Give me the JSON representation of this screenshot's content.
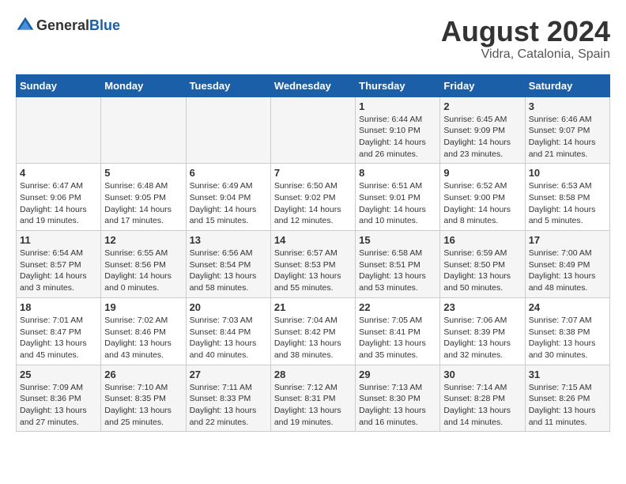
{
  "header": {
    "logo_general": "General",
    "logo_blue": "Blue",
    "month_year": "August 2024",
    "location": "Vidra, Catalonia, Spain"
  },
  "days_of_week": [
    "Sunday",
    "Monday",
    "Tuesday",
    "Wednesday",
    "Thursday",
    "Friday",
    "Saturday"
  ],
  "weeks": [
    [
      {
        "day": "",
        "info": ""
      },
      {
        "day": "",
        "info": ""
      },
      {
        "day": "",
        "info": ""
      },
      {
        "day": "",
        "info": ""
      },
      {
        "day": "1",
        "info": "Sunrise: 6:44 AM\nSunset: 9:10 PM\nDaylight: 14 hours\nand 26 minutes."
      },
      {
        "day": "2",
        "info": "Sunrise: 6:45 AM\nSunset: 9:09 PM\nDaylight: 14 hours\nand 23 minutes."
      },
      {
        "day": "3",
        "info": "Sunrise: 6:46 AM\nSunset: 9:07 PM\nDaylight: 14 hours\nand 21 minutes."
      }
    ],
    [
      {
        "day": "4",
        "info": "Sunrise: 6:47 AM\nSunset: 9:06 PM\nDaylight: 14 hours\nand 19 minutes."
      },
      {
        "day": "5",
        "info": "Sunrise: 6:48 AM\nSunset: 9:05 PM\nDaylight: 14 hours\nand 17 minutes."
      },
      {
        "day": "6",
        "info": "Sunrise: 6:49 AM\nSunset: 9:04 PM\nDaylight: 14 hours\nand 15 minutes."
      },
      {
        "day": "7",
        "info": "Sunrise: 6:50 AM\nSunset: 9:02 PM\nDaylight: 14 hours\nand 12 minutes."
      },
      {
        "day": "8",
        "info": "Sunrise: 6:51 AM\nSunset: 9:01 PM\nDaylight: 14 hours\nand 10 minutes."
      },
      {
        "day": "9",
        "info": "Sunrise: 6:52 AM\nSunset: 9:00 PM\nDaylight: 14 hours\nand 8 minutes."
      },
      {
        "day": "10",
        "info": "Sunrise: 6:53 AM\nSunset: 8:58 PM\nDaylight: 14 hours\nand 5 minutes."
      }
    ],
    [
      {
        "day": "11",
        "info": "Sunrise: 6:54 AM\nSunset: 8:57 PM\nDaylight: 14 hours\nand 3 minutes."
      },
      {
        "day": "12",
        "info": "Sunrise: 6:55 AM\nSunset: 8:56 PM\nDaylight: 14 hours\nand 0 minutes."
      },
      {
        "day": "13",
        "info": "Sunrise: 6:56 AM\nSunset: 8:54 PM\nDaylight: 13 hours\nand 58 minutes."
      },
      {
        "day": "14",
        "info": "Sunrise: 6:57 AM\nSunset: 8:53 PM\nDaylight: 13 hours\nand 55 minutes."
      },
      {
        "day": "15",
        "info": "Sunrise: 6:58 AM\nSunset: 8:51 PM\nDaylight: 13 hours\nand 53 minutes."
      },
      {
        "day": "16",
        "info": "Sunrise: 6:59 AM\nSunset: 8:50 PM\nDaylight: 13 hours\nand 50 minutes."
      },
      {
        "day": "17",
        "info": "Sunrise: 7:00 AM\nSunset: 8:49 PM\nDaylight: 13 hours\nand 48 minutes."
      }
    ],
    [
      {
        "day": "18",
        "info": "Sunrise: 7:01 AM\nSunset: 8:47 PM\nDaylight: 13 hours\nand 45 minutes."
      },
      {
        "day": "19",
        "info": "Sunrise: 7:02 AM\nSunset: 8:46 PM\nDaylight: 13 hours\nand 43 minutes."
      },
      {
        "day": "20",
        "info": "Sunrise: 7:03 AM\nSunset: 8:44 PM\nDaylight: 13 hours\nand 40 minutes."
      },
      {
        "day": "21",
        "info": "Sunrise: 7:04 AM\nSunset: 8:42 PM\nDaylight: 13 hours\nand 38 minutes."
      },
      {
        "day": "22",
        "info": "Sunrise: 7:05 AM\nSunset: 8:41 PM\nDaylight: 13 hours\nand 35 minutes."
      },
      {
        "day": "23",
        "info": "Sunrise: 7:06 AM\nSunset: 8:39 PM\nDaylight: 13 hours\nand 32 minutes."
      },
      {
        "day": "24",
        "info": "Sunrise: 7:07 AM\nSunset: 8:38 PM\nDaylight: 13 hours\nand 30 minutes."
      }
    ],
    [
      {
        "day": "25",
        "info": "Sunrise: 7:09 AM\nSunset: 8:36 PM\nDaylight: 13 hours\nand 27 minutes."
      },
      {
        "day": "26",
        "info": "Sunrise: 7:10 AM\nSunset: 8:35 PM\nDaylight: 13 hours\nand 25 minutes."
      },
      {
        "day": "27",
        "info": "Sunrise: 7:11 AM\nSunset: 8:33 PM\nDaylight: 13 hours\nand 22 minutes."
      },
      {
        "day": "28",
        "info": "Sunrise: 7:12 AM\nSunset: 8:31 PM\nDaylight: 13 hours\nand 19 minutes."
      },
      {
        "day": "29",
        "info": "Sunrise: 7:13 AM\nSunset: 8:30 PM\nDaylight: 13 hours\nand 16 minutes."
      },
      {
        "day": "30",
        "info": "Sunrise: 7:14 AM\nSunset: 8:28 PM\nDaylight: 13 hours\nand 14 minutes."
      },
      {
        "day": "31",
        "info": "Sunrise: 7:15 AM\nSunset: 8:26 PM\nDaylight: 13 hours\nand 11 minutes."
      }
    ]
  ]
}
